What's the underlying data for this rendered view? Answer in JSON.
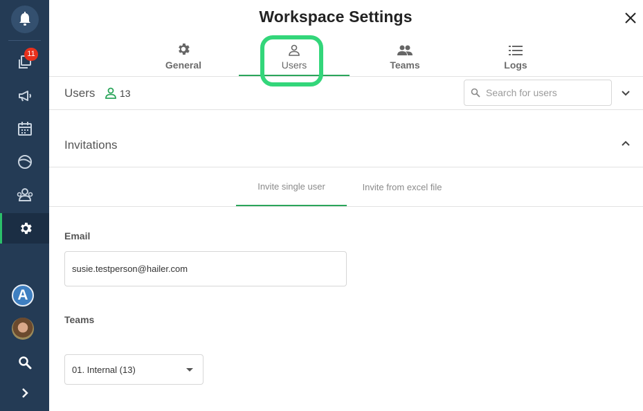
{
  "sidebar": {
    "notification_badge": "11",
    "avatar_letter": "A",
    "items": [
      {
        "icon": "bell-icon"
      },
      {
        "icon": "posts-icon"
      },
      {
        "icon": "megaphone-icon"
      },
      {
        "icon": "calendar-icon"
      },
      {
        "icon": "globe-icon"
      },
      {
        "icon": "people-group-icon"
      },
      {
        "icon": "gear-icon",
        "active": true
      },
      {
        "icon": "search-icon"
      },
      {
        "icon": "expand-chevron-icon"
      }
    ]
  },
  "header": {
    "title": "Workspace Settings"
  },
  "tabs": [
    {
      "label": "General",
      "icon": "gear-icon"
    },
    {
      "label": "Users",
      "icon": "person-icon",
      "active": true
    },
    {
      "label": "Teams",
      "icon": "people-icon"
    },
    {
      "label": "Logs",
      "icon": "list-icon"
    }
  ],
  "users_section": {
    "title": "Users",
    "count": "13",
    "search_placeholder": "Search for users"
  },
  "invitations": {
    "title": "Invitations",
    "subtabs": [
      {
        "label": "Invite single user",
        "active": true
      },
      {
        "label": "Invite from excel file"
      }
    ],
    "email_label": "Email",
    "email_value": "susie.testperson@hailer.com",
    "teams_label": "Teams",
    "teams_selected": "01. Internal (13)"
  },
  "colors": {
    "sidebar_bg": "#243b55",
    "accent_green": "#2aa55a",
    "highlight_green": "#33d67a",
    "badge_red": "#e8301c"
  }
}
